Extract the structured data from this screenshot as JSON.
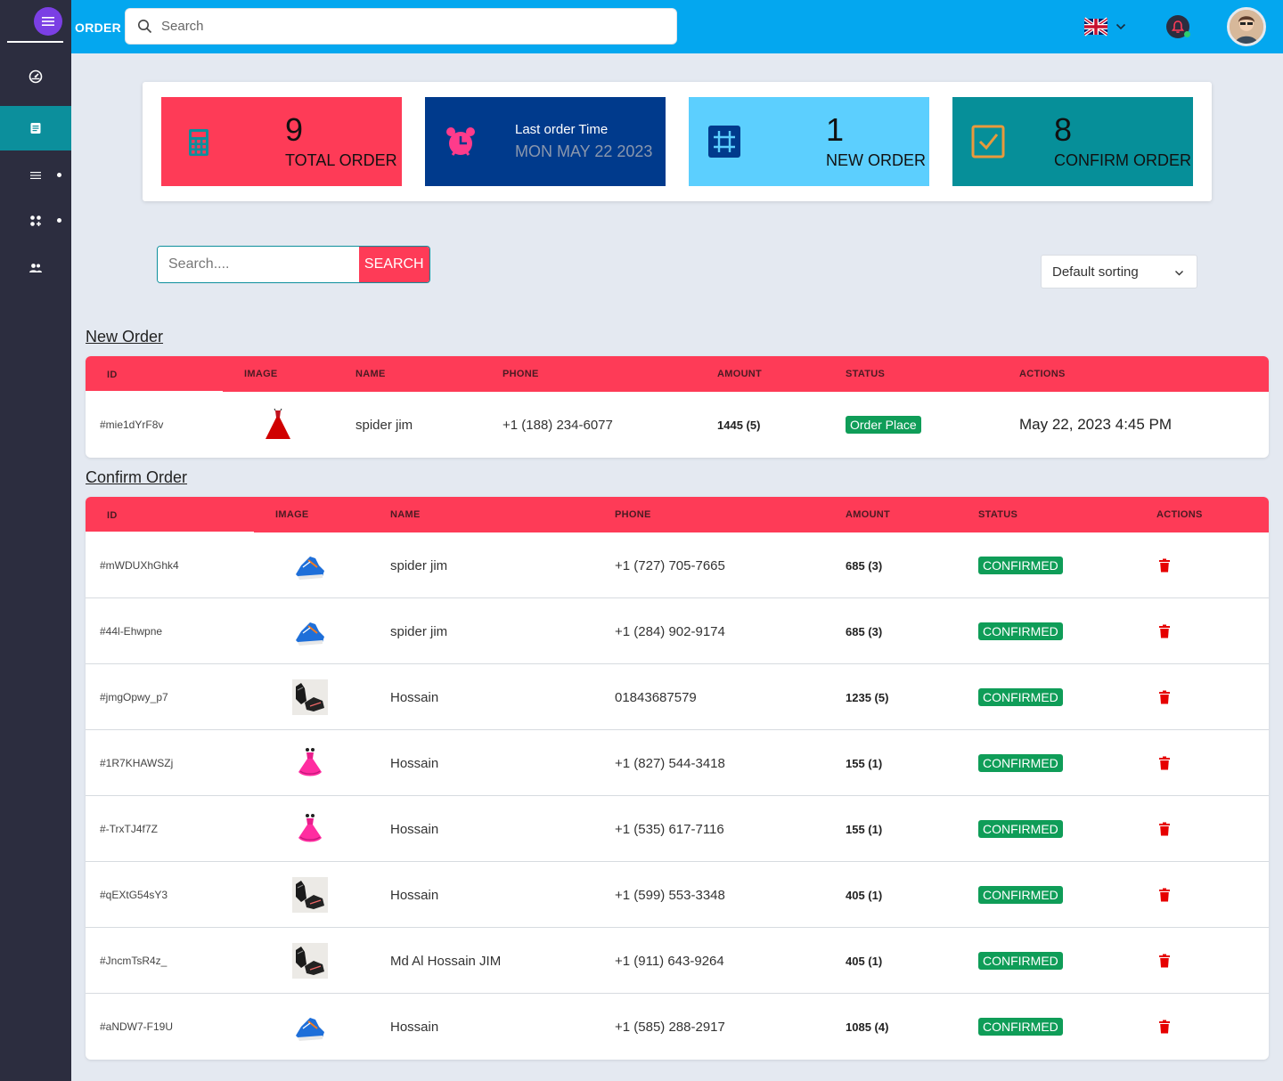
{
  "topbar": {
    "title": "ORDER",
    "search_placeholder": "Search",
    "icons": [
      "hamburger-icon",
      "search-icon",
      "uk-flag-icon",
      "chevron-down-icon",
      "bell-icon",
      "avatar"
    ]
  },
  "sidebar": {
    "items": [
      {
        "icon": "dashboard-icon",
        "active": false
      },
      {
        "icon": "document-icon",
        "active": true
      },
      {
        "icon": "list-icon",
        "active": false,
        "dot": true
      },
      {
        "icon": "apps-icon",
        "active": false,
        "dot": true
      },
      {
        "icon": "users-icon",
        "active": false
      }
    ]
  },
  "stats": {
    "total": {
      "value": "9",
      "label": "TOTAL ORDER",
      "color": "#fe3b57"
    },
    "last_order": {
      "label": "Last order Time",
      "value": "MON MAY 22 2023",
      "color": "#003a8c"
    },
    "new": {
      "value": "1",
      "label": "NEW ORDER",
      "color": "#5ccffe"
    },
    "confirm": {
      "value": "8",
      "label": "CONFIRM ORDER",
      "color": "#068f99"
    }
  },
  "filter": {
    "search_placeholder": "Search....",
    "search_button": "SEARCH",
    "sort_value": "Default sorting"
  },
  "new_order": {
    "title": "New Order",
    "columns": [
      "ID",
      "IMAGE",
      "NAME",
      "PHONE",
      "AMOUNT",
      "STATUS",
      "ACTIONS"
    ],
    "rows": [
      {
        "id": "#mie1dYrF8v",
        "image": "red-dress",
        "name": "spider jim",
        "phone": "+1 (188) 234-6077",
        "amount": "1445 (5)",
        "status": "Order Place",
        "action": "May 22, 2023 4:45 PM"
      }
    ]
  },
  "confirm_order": {
    "title": "Confirm Order",
    "columns": [
      "ID",
      "IMAGE",
      "NAME",
      "PHONE",
      "AMOUNT",
      "STATUS",
      "ACTIONS"
    ],
    "rows": [
      {
        "id": "#mWDUXhGhk4",
        "image": "blue-shoe",
        "name": "spider jim",
        "phone": "+1 (727) 705-7665",
        "amount": "685 (3)",
        "status": "CONFIRMED"
      },
      {
        "id": "#44l-Ehwpne",
        "image": "blue-shoe",
        "name": "spider jim",
        "phone": "+1 (284) 902-9174",
        "amount": "685 (3)",
        "status": "CONFIRMED"
      },
      {
        "id": "#jmgOpwy_p7",
        "image": "black-shoe",
        "name": "Hossain",
        "phone": "01843687579",
        "amount": "1235 (5)",
        "status": "CONFIRMED"
      },
      {
        "id": "#1R7KHAWSZj",
        "image": "pink-dress",
        "name": "Hossain",
        "phone": "+1 (827) 544-3418",
        "amount": "155 (1)",
        "status": "CONFIRMED"
      },
      {
        "id": "#-TrxTJ4f7Z",
        "image": "pink-dress",
        "name": "Hossain",
        "phone": "+1 (535) 617-7116",
        "amount": "155 (1)",
        "status": "CONFIRMED"
      },
      {
        "id": "#qEXtG54sY3",
        "image": "black-shoe",
        "name": "Hossain",
        "phone": "+1 (599) 553-3348",
        "amount": "405 (1)",
        "status": "CONFIRMED"
      },
      {
        "id": "#JncmTsR4z_",
        "image": "black-shoe",
        "name": "Md Al Hossain JIM",
        "phone": "+1 (911) 643-9264",
        "amount": "405 (1)",
        "status": "CONFIRMED"
      },
      {
        "id": "#aNDW7-F19U",
        "image": "blue-shoe",
        "name": "Hossain",
        "phone": "+1 (585) 288-2917",
        "amount": "1085 (4)",
        "status": "CONFIRMED"
      }
    ]
  }
}
